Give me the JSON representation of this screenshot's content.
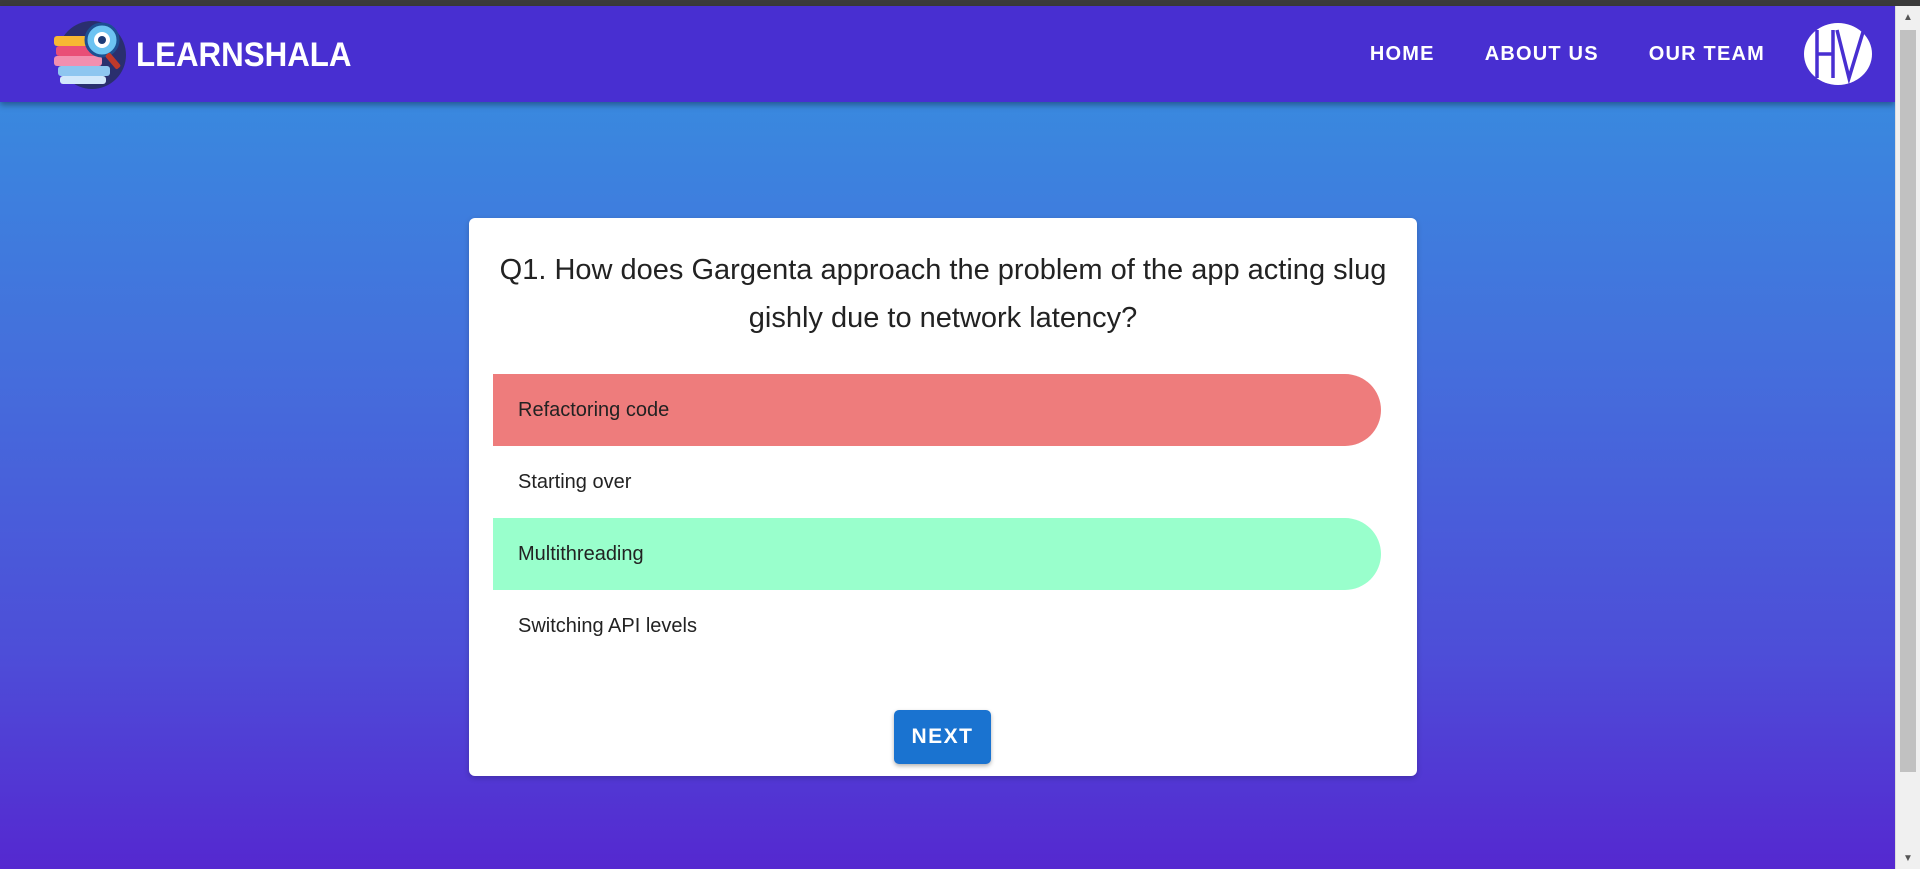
{
  "brand": {
    "name": "LEARNSHALA"
  },
  "nav": {
    "links": [
      {
        "label": "HOME"
      },
      {
        "label": "ABOUT US"
      },
      {
        "label": "OUR TEAM"
      }
    ]
  },
  "quiz": {
    "question": "Q1. How does Gargenta approach the problem of the app acting sluggishly due to network latency?",
    "options": [
      {
        "label": "Refactoring code",
        "state": "wrong"
      },
      {
        "label": "Starting over",
        "state": "neutral"
      },
      {
        "label": "Multithreading",
        "state": "correct"
      },
      {
        "label": "Switching API levels",
        "state": "neutral"
      }
    ],
    "next_label": "NEXT"
  },
  "colors": {
    "navbar": "#482fd1",
    "wrong": "#ee7c7c",
    "correct": "#99ffcc",
    "button": "#1a73d0"
  },
  "icons": {
    "logo": "books-magnifier-logo-icon",
    "avatar": "hv-monogram-avatar-icon"
  }
}
